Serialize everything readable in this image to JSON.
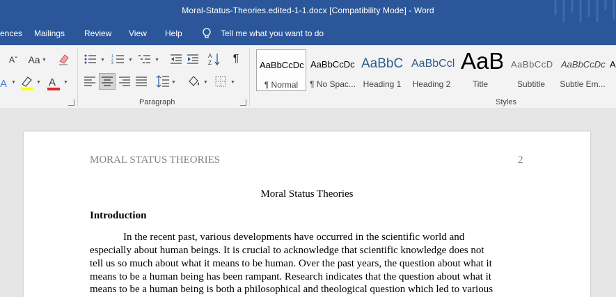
{
  "window": {
    "title": "Moral-Status-Theories.edited-1-1.docx [Compatibility Mode]  -  Word",
    "title_bar_color": "#2b579a"
  },
  "tabs": {
    "items": [
      "ences",
      "Mailings",
      "Review",
      "View",
      "Help"
    ],
    "tell_me": "Tell me what you want to do"
  },
  "ribbon": {
    "paragraph_group": "Paragraph",
    "styles_group": "Styles",
    "icons": {
      "font_size": "Aˇ",
      "change_case": "Aa",
      "pilcrow": "¶"
    }
  },
  "styles": [
    {
      "preview": "AaBbCcDc",
      "name": "¶ Normal",
      "selected": true
    },
    {
      "preview": "AaBbCcDc",
      "name": "¶ No Spac..."
    },
    {
      "preview": "AaBbC",
      "name": "Heading 1"
    },
    {
      "preview": "AaBbCcl",
      "name": "Heading 2"
    },
    {
      "preview": "AaB",
      "name": "Title"
    },
    {
      "preview": "AaBbCcD",
      "name": "Subtitle"
    },
    {
      "preview": "AaBbCcDc",
      "name": "Subtle Em..."
    },
    {
      "preview": "A",
      "name": ""
    }
  ],
  "document": {
    "header_left": "MORAL STATUS THEORIES",
    "header_right": "2",
    "title": "Moral Status Theories",
    "heading": "Introduction",
    "paragraph_lines": [
      "In the recent past, various developments have occurred in the scientific world and",
      "especially about human beings. It is crucial to acknowledge that scientific knowledge does not",
      "tell us so much about what it means to be human. Over the past years, the question about what it",
      "means to be a human being has been rampant. Research indicates that the question about what it",
      "means to be a human being is both a philosophical and theological question which led to various"
    ]
  }
}
